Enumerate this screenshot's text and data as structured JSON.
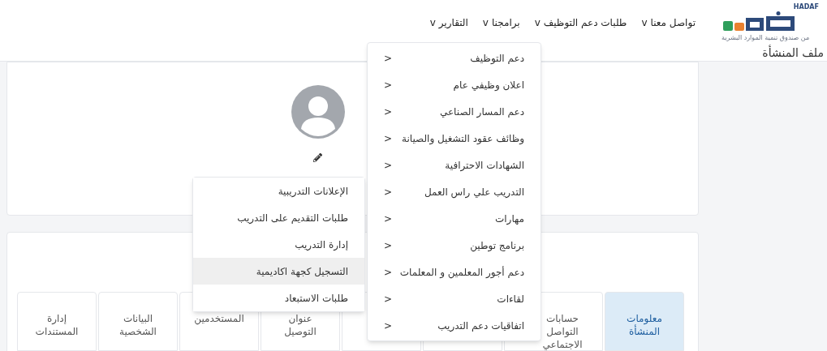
{
  "logo": {
    "latin": "HADAF",
    "tagline": "من صندوق تنمية الموارد البشرية"
  },
  "nav": [
    {
      "label": "تواصل معنا",
      "caret": "v"
    },
    {
      "label": "طلبات دعم التوظيف",
      "caret": "v"
    },
    {
      "label": "برامجنا",
      "caret": "v"
    },
    {
      "label": "التقارير",
      "caret": "v"
    }
  ],
  "page_title": "ملف المنشأة",
  "menu": {
    "items": [
      {
        "label": "دعم التوظيف",
        "arrow": "<"
      },
      {
        "label": "اعلان وظيفي عام",
        "arrow": "<"
      },
      {
        "label": "دعم المسار الصناعي",
        "arrow": "<"
      },
      {
        "label": "وظائف عقود التشغيل والصيانة",
        "arrow": "<"
      },
      {
        "label": "الشهادات الاحترافية",
        "arrow": "<"
      },
      {
        "label": "التدريب علي راس العمل",
        "arrow": "<"
      },
      {
        "label": "مهارات",
        "arrow": "<"
      },
      {
        "label": "برنامج توطين",
        "arrow": "<"
      },
      {
        "label": "دعم أجور المعلمين و المعلمات",
        "arrow": "<"
      },
      {
        "label": "لقاءات",
        "arrow": "<"
      },
      {
        "label": "اتفاقيات دعم التدريب",
        "arrow": "<"
      }
    ]
  },
  "submenu": {
    "items": [
      {
        "label": "الإعلانات التدريبية",
        "selected": false
      },
      {
        "label": "طلبات التقديم على التدريب",
        "selected": false
      },
      {
        "label": "إدارة التدريب",
        "selected": false
      },
      {
        "label": "التسجيل كجهة اكاديمية",
        "selected": true
      },
      {
        "label": "طلبات الاستبعاد",
        "selected": false
      }
    ]
  },
  "tabs": [
    {
      "label": "معلومات المنشأة",
      "selected": true
    },
    {
      "label": "حسابات التواصل الاجتماعي",
      "selected": false
    },
    {
      "selected": false
    },
    {
      "selected": false
    },
    {
      "label": "عنوان التوصيل",
      "selected": false
    },
    {
      "label": "المستخدمين",
      "selected": false
    },
    {
      "label": "البيانات الشخصية",
      "selected": false
    },
    {
      "label": "إدارة المستندات",
      "selected": false
    }
  ]
}
